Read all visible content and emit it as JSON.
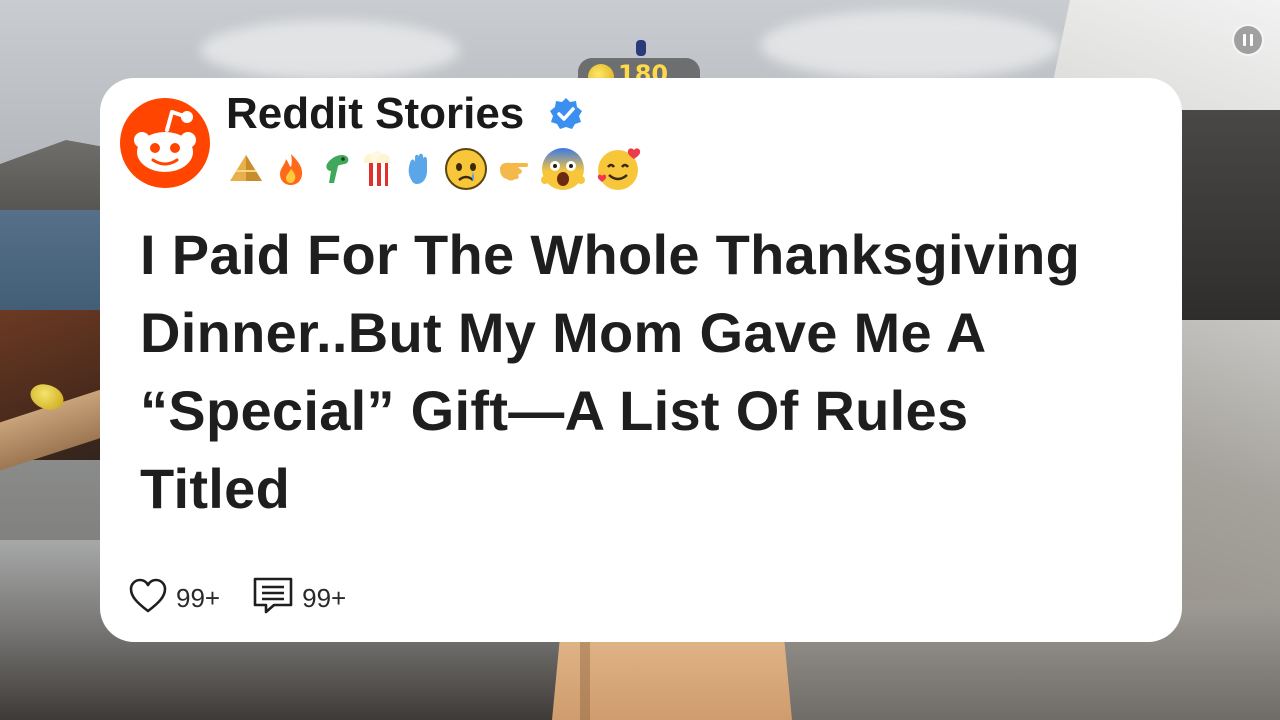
{
  "hud": {
    "coins": "180",
    "pause_icon": "pause-icon"
  },
  "card": {
    "channel_name": "Reddit Stories",
    "avatar_icon": "reddit-logo-icon",
    "verified_icon": "verified-badge-icon",
    "emojis": [
      "pyramid-emoji",
      "fire-emoji",
      "green-dinosaur-emoji",
      "popcorn-emoji",
      "raised-hand-emoji",
      "crying-face-emoji",
      "pointing-hand-emoji",
      "screaming-face-emoji",
      "smiling-face-with-hearts-emoji"
    ],
    "title_lines": [
      "I Paid For The Whole Thanksgiving",
      "Dinner..But My Mom Gave Me A",
      "“Special” Gift—A List Of Rules",
      "Titled"
    ],
    "likes_label": "99+",
    "comments_label": "99+"
  },
  "colors": {
    "reddit_orange": "#ff4500",
    "verified_blue": "#3b8ff0",
    "card_background": "#ffffff",
    "text_dark": "#1e1e1e"
  }
}
